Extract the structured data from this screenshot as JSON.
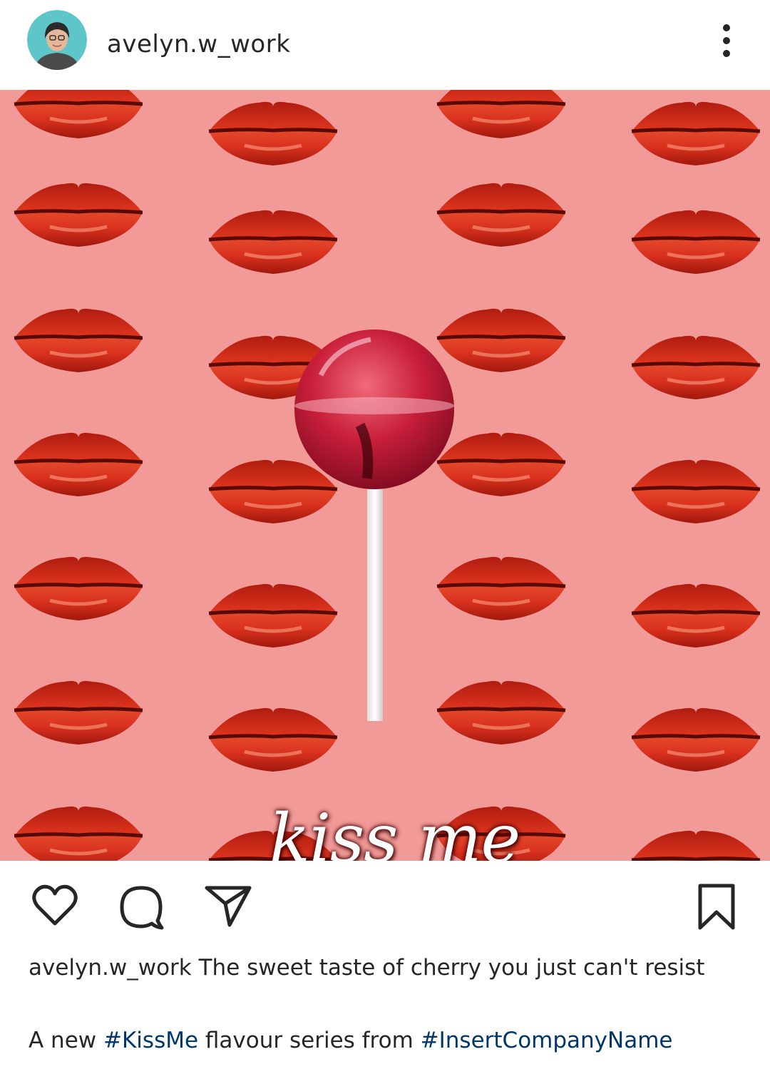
{
  "post": {
    "username": "avelyn.w_work",
    "image_overlay_text": "kiss me",
    "caption": {
      "username": "avelyn.w_work",
      "text": "The sweet taste of cherry you just can't resist",
      "line2_prefix": "A new",
      "hashtag1": "#KissMe",
      "line2_middle": "flavour series from",
      "hashtag2": "#InsertCompanyName"
    }
  },
  "icons": {
    "more": "more-vertical-icon",
    "like": "heart-icon",
    "comment": "comment-icon",
    "share": "send-icon",
    "save": "bookmark-icon"
  },
  "colors": {
    "background": "#f29a98",
    "lips": "#d8301e",
    "hashtag": "#00376b",
    "avatar_ring": "#5ec6c8"
  }
}
